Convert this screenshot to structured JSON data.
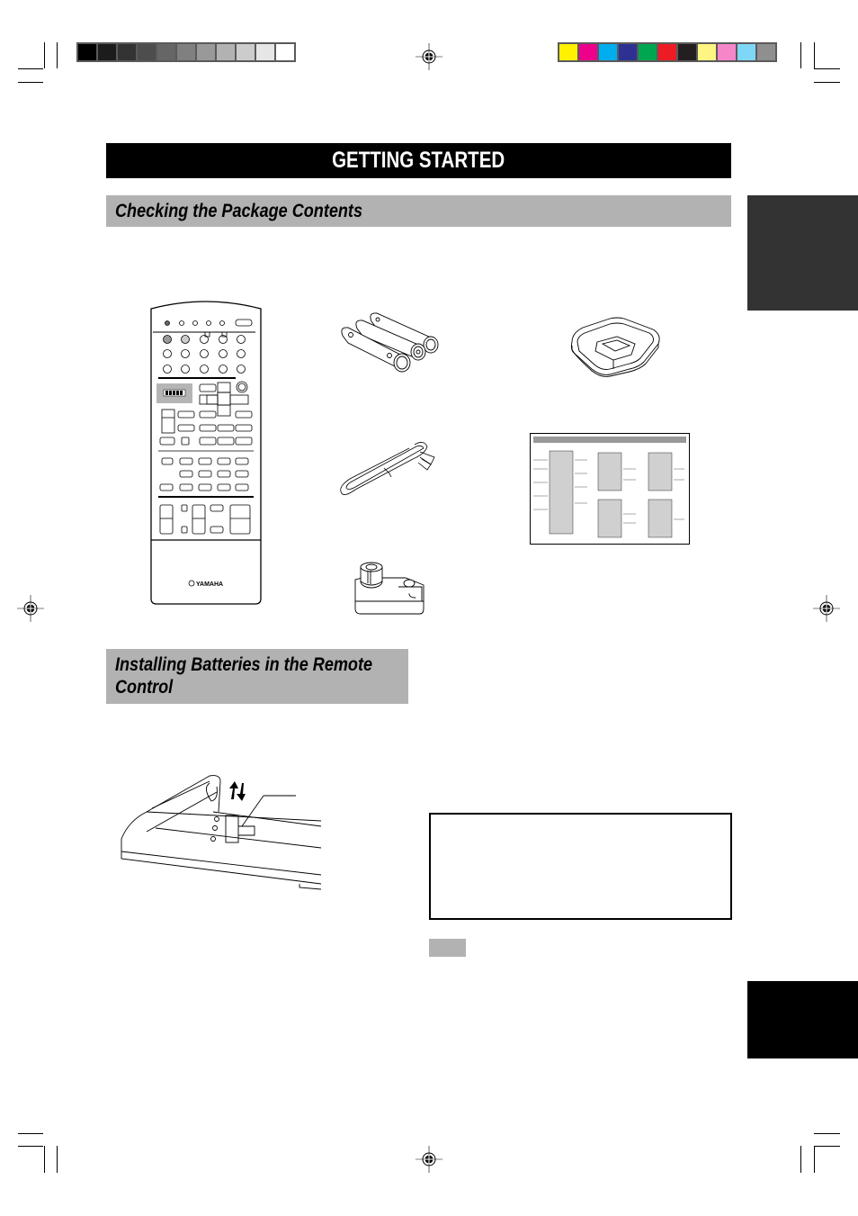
{
  "page": {
    "title": "GETTING STARTED",
    "sections": [
      {
        "id": "package-contents",
        "heading": "Checking the Package Contents"
      },
      {
        "id": "installing-batteries",
        "heading": "Installing Batteries in the Remote Control"
      }
    ]
  },
  "package_contents": {
    "items": [
      {
        "name": "remote-control",
        "icon": "remote-control-illustration",
        "brand_label": "YAMAHA"
      },
      {
        "name": "batteries",
        "icon": "aa-batteries-illustration",
        "count": 3
      },
      {
        "name": "am-loop-antenna",
        "icon": "loop-antenna-illustration"
      },
      {
        "name": "indoor-fm-antenna",
        "icon": "fm-antenna-cable-illustration"
      },
      {
        "name": "quick-reference-card",
        "icon": "quick-reference-card-illustration"
      },
      {
        "name": "antenna-adapter",
        "icon": "antenna-adapter-illustration"
      }
    ]
  },
  "battery_diagram": {
    "icon": "battery-compartment-illustration"
  },
  "note": {
    "box_text": "",
    "label_text": ""
  },
  "print_marks": {
    "grayscale_swatches": [
      "#000000",
      "#1c1c1c",
      "#333333",
      "#4d4d4d",
      "#666666",
      "#808080",
      "#999999",
      "#b2b2b2",
      "#cccccc",
      "#e6e6e6",
      "#ffffff"
    ],
    "color_swatches": [
      "#fff100",
      "#ec008c",
      "#00aeef",
      "#2e3192",
      "#00a651",
      "#ed1c24",
      "#231f20",
      "#fff582",
      "#f587c8",
      "#7fd7f7",
      "#8f8f8f"
    ]
  },
  "side_tabs": [
    {
      "name": "language-tab-dark",
      "color": "#333333"
    },
    {
      "name": "language-tab-black",
      "color": "#000000"
    }
  ]
}
